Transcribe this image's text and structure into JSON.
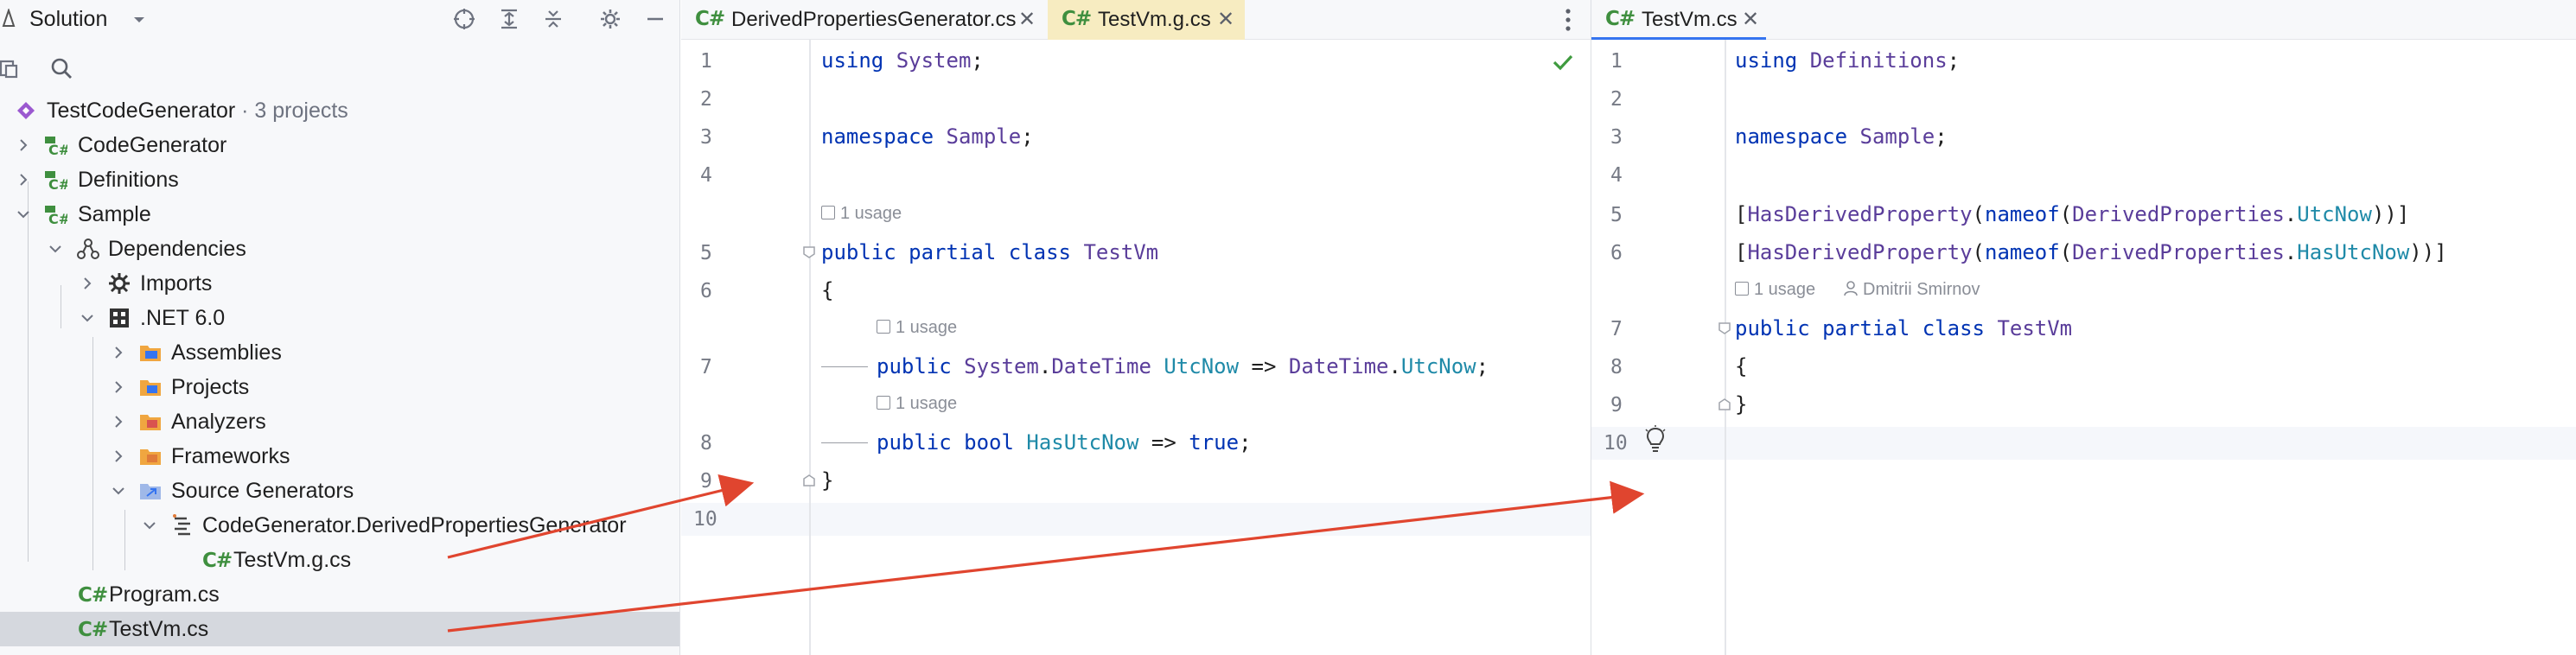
{
  "solution": {
    "title": "Solution",
    "tree": [
      {
        "label": "TestCodeGenerator",
        "suffix": "· 3 projects"
      },
      {
        "label": "CodeGenerator"
      },
      {
        "label": "Definitions"
      },
      {
        "label": "Sample"
      },
      {
        "label": "Dependencies"
      },
      {
        "label": "Imports"
      },
      {
        "label": ".NET 6.0"
      },
      {
        "label": "Assemblies"
      },
      {
        "label": "Projects"
      },
      {
        "label": "Analyzers"
      },
      {
        "label": "Frameworks"
      },
      {
        "label": "Source Generators"
      },
      {
        "label": "CodeGenerator.DerivedPropertiesGenerator"
      },
      {
        "label": "TestVm.g.cs"
      },
      {
        "label": "Program.cs"
      },
      {
        "label": "TestVm.cs"
      }
    ],
    "cs_badge": "C#"
  },
  "left_editor": {
    "tabs": [
      {
        "badge": "C#",
        "name": "DerivedPropertiesGenerator.cs",
        "close": "✕"
      },
      {
        "badge": "C#",
        "name": "TestVm.g.cs",
        "close": "✕"
      }
    ],
    "line_numbers": [
      "1",
      "2",
      "3",
      "4",
      "5",
      "6",
      "7",
      "8",
      "9",
      "10"
    ],
    "hints": [
      "1 usage",
      "1 usage",
      "1 usage"
    ],
    "code": {
      "l1_kw": "using",
      "l1_ns": "System",
      "l1_end": ";",
      "l3_kw": "namespace",
      "l3_ns": "Sample",
      "l3_end": ";",
      "l5_kw": "public partial class",
      "l5_type": "TestVm",
      "l6": "{",
      "l7_kw": "public",
      "l7_type1": "System",
      "l7_dot": ".",
      "l7_type2": "DateTime",
      "l7_mem": "UtcNow",
      "l7_arrow": "=>",
      "l7_type3": "DateTime",
      "l7_dot2": ".",
      "l7_mem2": "UtcNow",
      "l7_end": ";",
      "l8_kw": "public bool",
      "l8_mem": "HasUtcNow",
      "l8_arrow": "=>",
      "l8_kw2": "true",
      "l8_end": ";",
      "l9": "}"
    }
  },
  "right_editor": {
    "tab": {
      "badge": "C#",
      "name": "TestVm.cs",
      "close": "✕"
    },
    "line_numbers": [
      "1",
      "2",
      "3",
      "4",
      "5",
      "6",
      "7",
      "8",
      "9",
      "10"
    ],
    "hint_usage": "1 usage",
    "hint_author": "Dmitrii Smirnov",
    "code": {
      "l1_kw": "using",
      "l1_ns": "Definitions",
      "l1_end": ";",
      "l3_kw": "namespace",
      "l3_ns": "Sample",
      "l3_end": ";",
      "l5_a": "[",
      "l5_type": "HasDerivedProperty",
      "l5_b": "(",
      "l5_kw": "nameof",
      "l5_c": "(",
      "l5_type2": "DerivedProperties",
      "l5_dot": ".",
      "l5_mem": "UtcNow",
      "l5_end": "))]",
      "l6_a": "[",
      "l6_type": "HasDerivedProperty",
      "l6_b": "(",
      "l6_kw": "nameof",
      "l6_c": "(",
      "l6_type2": "DerivedProperties",
      "l6_dot": ".",
      "l6_mem": "HasUtcNow",
      "l6_end": "))]",
      "l7_kw": "public partial class",
      "l7_type": "TestVm",
      "l8": "{",
      "l9": "}"
    }
  },
  "colors": {
    "arrow": "#e0452f",
    "keyword": "#0033b3",
    "type": "#5a3d9a",
    "member": "#1f8aa8",
    "cs_badge": "#3f8f3f"
  }
}
